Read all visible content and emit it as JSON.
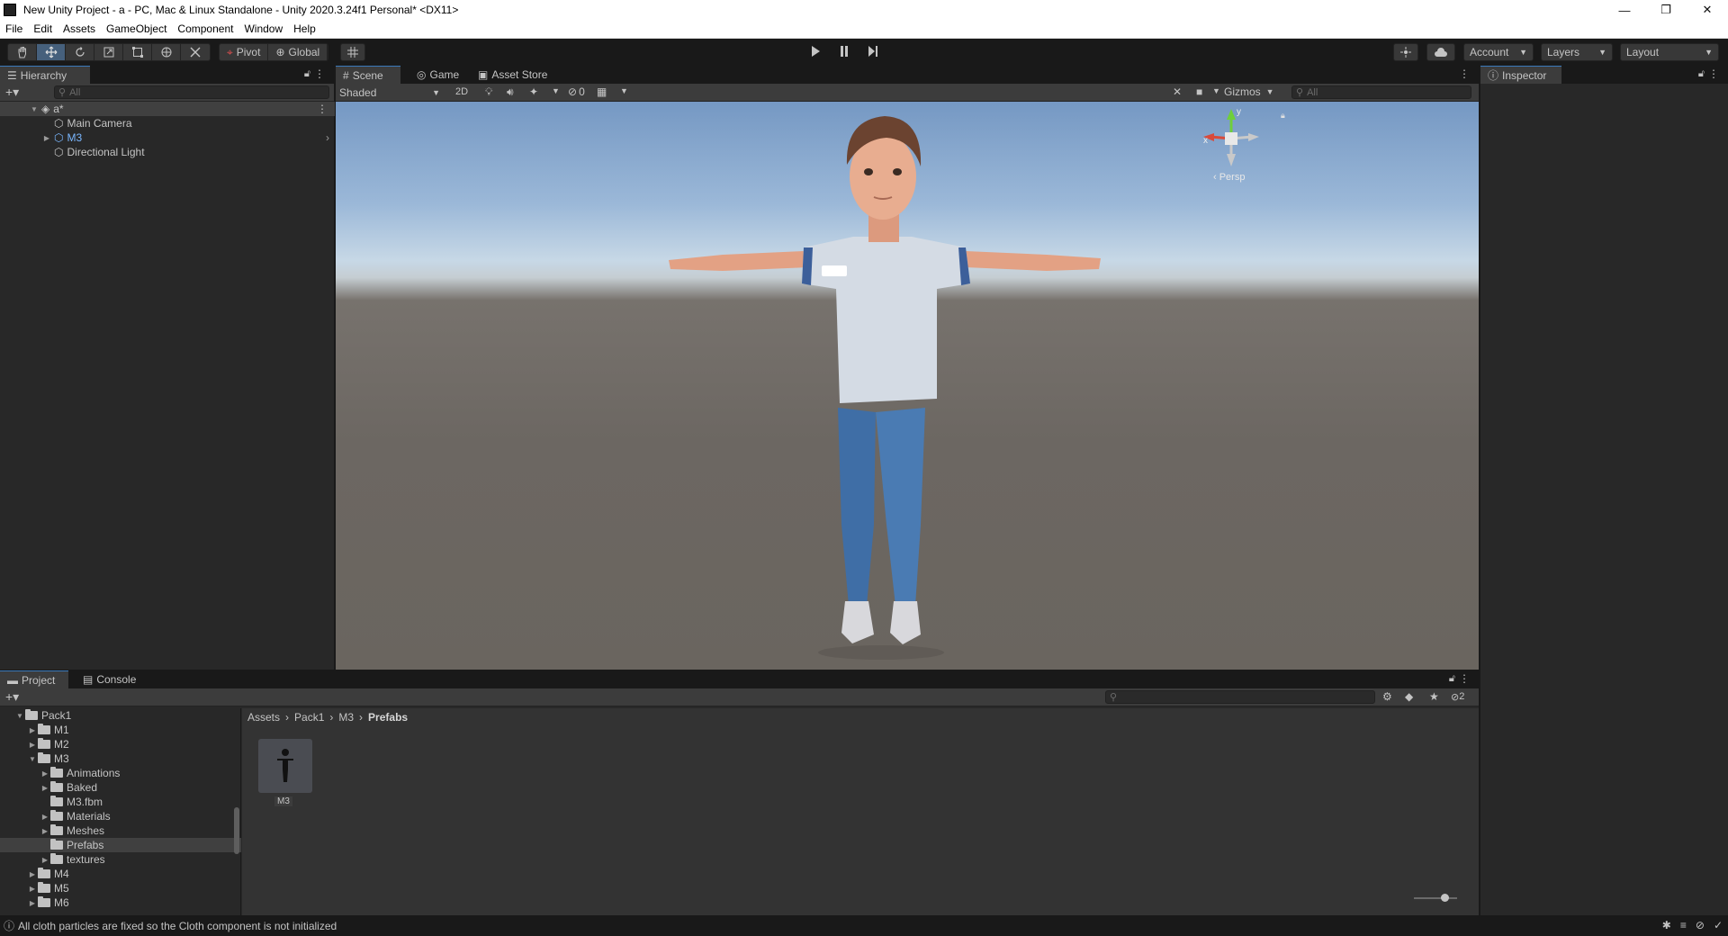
{
  "window": {
    "title": "New Unity Project - a - PC, Mac & Linux Standalone - Unity 2020.3.24f1 Personal* <DX11>",
    "minimize": "—",
    "maximize": "❐",
    "close": "✕"
  },
  "menubar": [
    "File",
    "Edit",
    "Assets",
    "GameObject",
    "Component",
    "Window",
    "Help"
  ],
  "toolbar": {
    "pivot_label": "Pivot",
    "global_label": "Global",
    "account_label": "Account",
    "layers_label": "Layers",
    "layout_label": "Layout"
  },
  "hierarchy": {
    "tab_label": "Hierarchy",
    "search_placeholder": "All",
    "scene_name": "a*",
    "items": [
      "Main Camera",
      "M3",
      "Directional Light"
    ]
  },
  "scene": {
    "tabs": [
      "Scene",
      "Game",
      "Asset Store"
    ],
    "shading_mode": "Shaded",
    "mode_2d": "2D",
    "hidden_count": "0",
    "gizmos_label": "Gizmos",
    "search_placeholder": "All",
    "persp_label": "‹ Persp",
    "gizmo_x": "x",
    "gizmo_y": "y"
  },
  "inspector": {
    "tab_label": "Inspector"
  },
  "project": {
    "tabs": [
      "Project",
      "Console"
    ],
    "breadcrumb": [
      "Assets",
      "Pack1",
      "M3",
      "Prefabs"
    ],
    "hidden_count": "2",
    "tree": [
      {
        "label": "Pack1",
        "arrow": "▼"
      },
      {
        "label": "M1",
        "arrow": "▶"
      },
      {
        "label": "M2",
        "arrow": "▶"
      },
      {
        "label": "M3",
        "arrow": "▼"
      },
      {
        "label": "Animations",
        "arrow": "▶"
      },
      {
        "label": "Baked",
        "arrow": "▶"
      },
      {
        "label": "M3.fbm",
        "arrow": ""
      },
      {
        "label": "Materials",
        "arrow": "▶"
      },
      {
        "label": "Meshes",
        "arrow": "▶"
      },
      {
        "label": "Prefabs",
        "arrow": ""
      },
      {
        "label": "textures",
        "arrow": "▶"
      },
      {
        "label": "M4",
        "arrow": "▶"
      },
      {
        "label": "M5",
        "arrow": "▶"
      },
      {
        "label": "M6",
        "arrow": "▶"
      }
    ],
    "assets": [
      {
        "label": "M3"
      }
    ]
  },
  "statusbar": {
    "message": "All cloth particles are fixed so the Cloth component is not initialized"
  },
  "colors": {
    "accent": "#3a79bb",
    "selection": "#46607c",
    "panel": "#282828",
    "background": "#191919"
  }
}
